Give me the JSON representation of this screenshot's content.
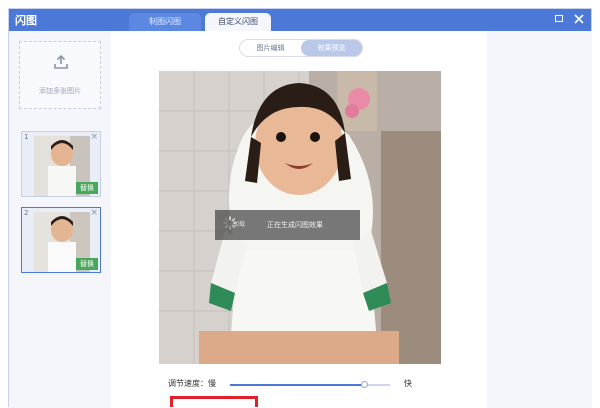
{
  "window": {
    "title": "闪图"
  },
  "tabs": [
    {
      "label": "制图闪图"
    },
    {
      "label": "自定义闪图"
    }
  ],
  "upload": {
    "label": "添加多张图片"
  },
  "thumbnails": [
    {
      "index": "1",
      "tag": "替换"
    },
    {
      "index": "2",
      "tag": "替换"
    }
  ],
  "view_toggle": {
    "options": [
      "图片编辑",
      "效果预览"
    ],
    "active": "效果预览"
  },
  "toast": {
    "label": "加载",
    "message": "正在生成闪图效果"
  },
  "speed": {
    "label": "调节速度：慢",
    "fast_label": "快",
    "value": 0.84
  },
  "colors": {
    "titlebar": "#4c78d8",
    "accent": "#4c78d8",
    "tag": "#47a75a",
    "highlight": "#e0202a"
  }
}
